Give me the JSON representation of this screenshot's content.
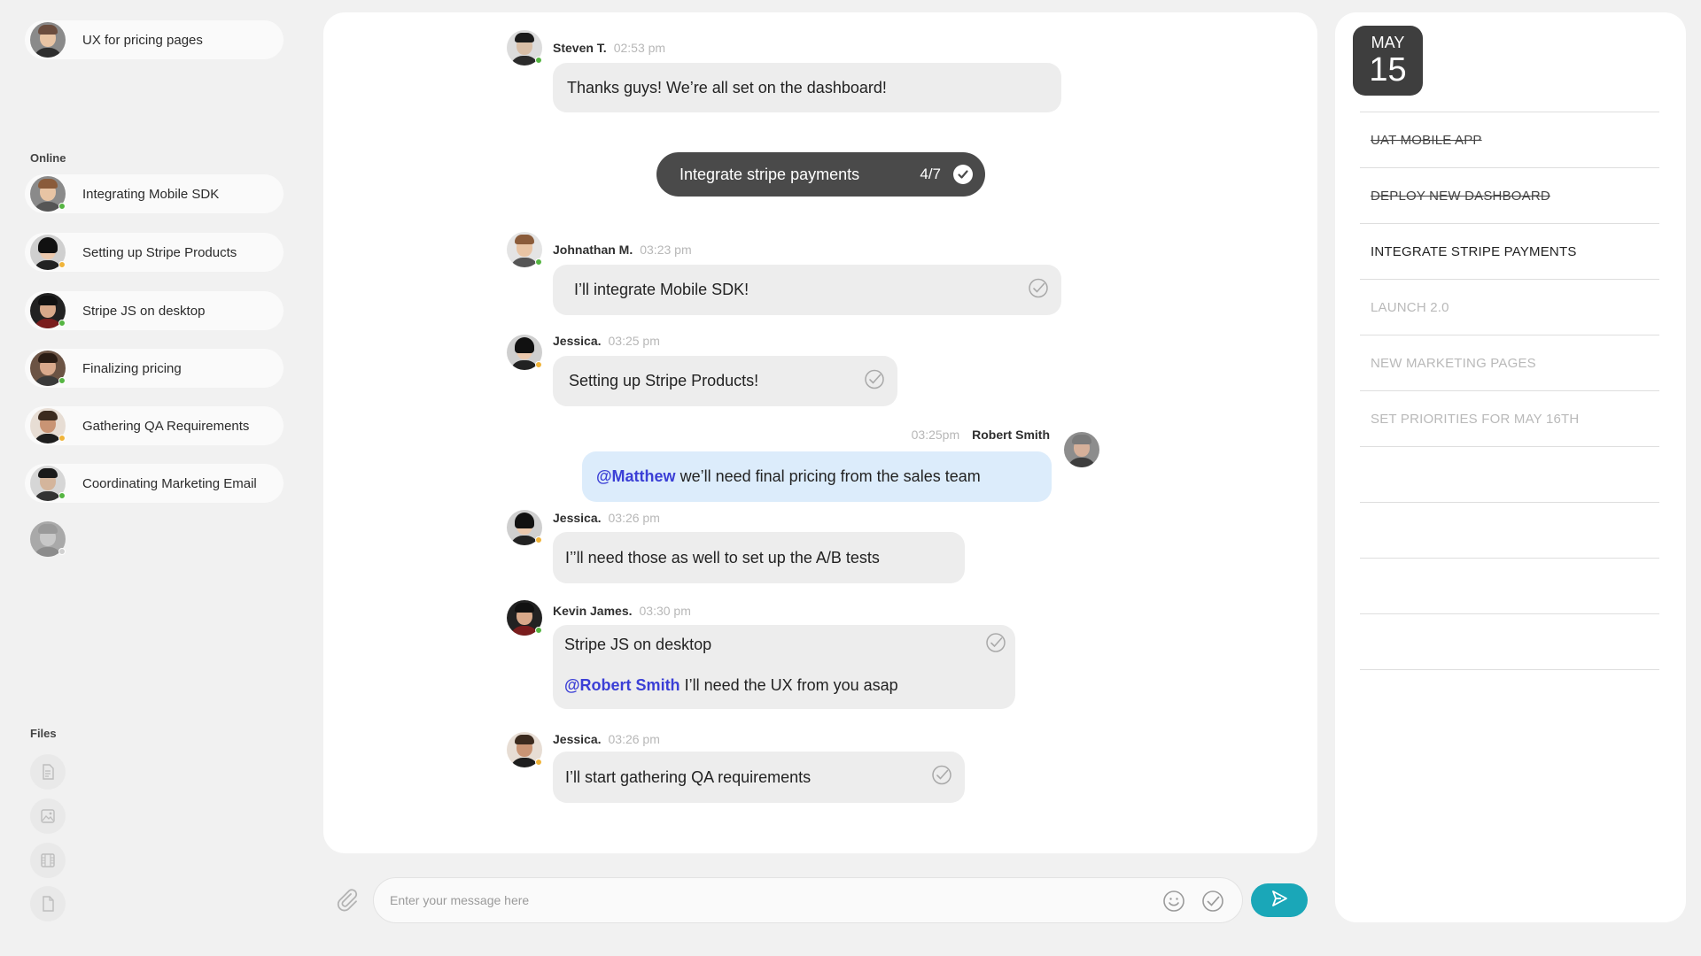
{
  "sidebar": {
    "top_channel": {
      "label": "UX for pricing pages"
    },
    "online_label": "Online",
    "online": [
      {
        "label": "Integrating Mobile SDK",
        "status": "green"
      },
      {
        "label": "Setting up Stripe Products",
        "status": "yellow"
      },
      {
        "label": "Stripe JS on desktop",
        "status": "green"
      },
      {
        "label": "Finalizing pricing",
        "status": "green"
      },
      {
        "label": "Gathering QA Requirements",
        "status": "yellow"
      },
      {
        "label": "Coordinating Marketing Email",
        "status": "green"
      }
    ],
    "files_label": "Files",
    "files": [
      {
        "icon": "document-icon"
      },
      {
        "icon": "image-icon"
      },
      {
        "icon": "film-icon"
      },
      {
        "icon": "file-icon"
      }
    ]
  },
  "chat": {
    "messages": [
      {
        "name": "Steven T.",
        "time": "02:53 pm",
        "text": "Thanks guys! We’re all set on the dashboard!"
      },
      {
        "name": "Johnathan M.",
        "time": "03:23 pm",
        "text": "I’ll integrate Mobile SDK!"
      },
      {
        "name": "Jessica.",
        "time": "03:25 pm",
        "text": "Setting up Stripe Products!"
      },
      {
        "name": "Robert Smith",
        "time": "03:25pm",
        "mention": "@Matthew",
        "text": " we’ll need final pricing from the sales team"
      },
      {
        "name": "Jessica.",
        "time": "03:26 pm",
        "text": "I’’ll need those as well to set up the A/B tests"
      },
      {
        "name": "Kevin James.",
        "time": "03:30 pm",
        "line1": "Stripe JS on desktop",
        "mention": "@Robert Smith",
        "text": " I’ll need the UX from you asap"
      },
      {
        "name": "Jessica.",
        "time": "03:26 pm",
        "text": "I’ll start gathering QA requirements"
      }
    ],
    "task_pill": {
      "label": "Integrate stripe payments",
      "progress": "4/7"
    }
  },
  "composer": {
    "placeholder": "Enter your message here"
  },
  "calendar": {
    "month": "MAY",
    "day": "15"
  },
  "tasks": [
    {
      "label": "UAT MOBILE APP",
      "state": "done"
    },
    {
      "label": "DEPLOY NEW DASHBOARD",
      "state": "done"
    },
    {
      "label": "INTEGRATE STRIPE PAYMENTS",
      "state": "active"
    },
    {
      "label": "LAUNCH 2.0",
      "state": "todo"
    },
    {
      "label": "NEW MARKETING PAGES",
      "state": "todo"
    },
    {
      "label": "SET PRIORITIES FOR MAY 16TH",
      "state": "todo"
    }
  ],
  "colors": {
    "accent": "#1aa7b8",
    "mention": "#3b3fd6",
    "online": "#55b542",
    "away": "#f0b43a",
    "highlight_bubble": "#dcecfb"
  }
}
